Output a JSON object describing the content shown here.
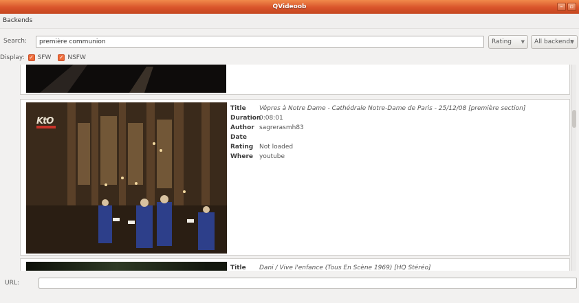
{
  "window": {
    "title": "QVideoob",
    "controls": [
      "–",
      "▫"
    ]
  },
  "menu": {
    "backends": "Backends"
  },
  "search": {
    "label": "Search:",
    "value": "première communion"
  },
  "sort": {
    "selected": "Rating"
  },
  "backend_filter": {
    "selected": "All backends"
  },
  "display": {
    "label": "Display:",
    "sfw": {
      "label": "SFW",
      "checked": true
    },
    "nsfw": {
      "label": "NSFW",
      "checked": true
    }
  },
  "results": {
    "item2": {
      "logo_text": "KtO",
      "fields": [
        {
          "key": "Title",
          "value": "Vêpres à Notre Dame - Cathédrale Notre-Dame de Paris - 25/12/08 [première section]"
        },
        {
          "key": "Duration",
          "value": "0:08:01"
        },
        {
          "key": "Author",
          "value": "sagrerasmh83"
        },
        {
          "key": "Date",
          "value": ""
        },
        {
          "key": "Rating",
          "value": "Not loaded"
        },
        {
          "key": "Where",
          "value": "youtube"
        }
      ]
    },
    "item3": {
      "fields": [
        {
          "key": "Title",
          "value": "Dani / Vive l'enfance (Tous En Scène 1969) [HQ Stéréo]"
        }
      ]
    }
  },
  "url": {
    "label": "URL:",
    "value": ""
  },
  "colors": {
    "titlebar": "#dd5a2c",
    "checkbox": "#ee6c3a"
  }
}
